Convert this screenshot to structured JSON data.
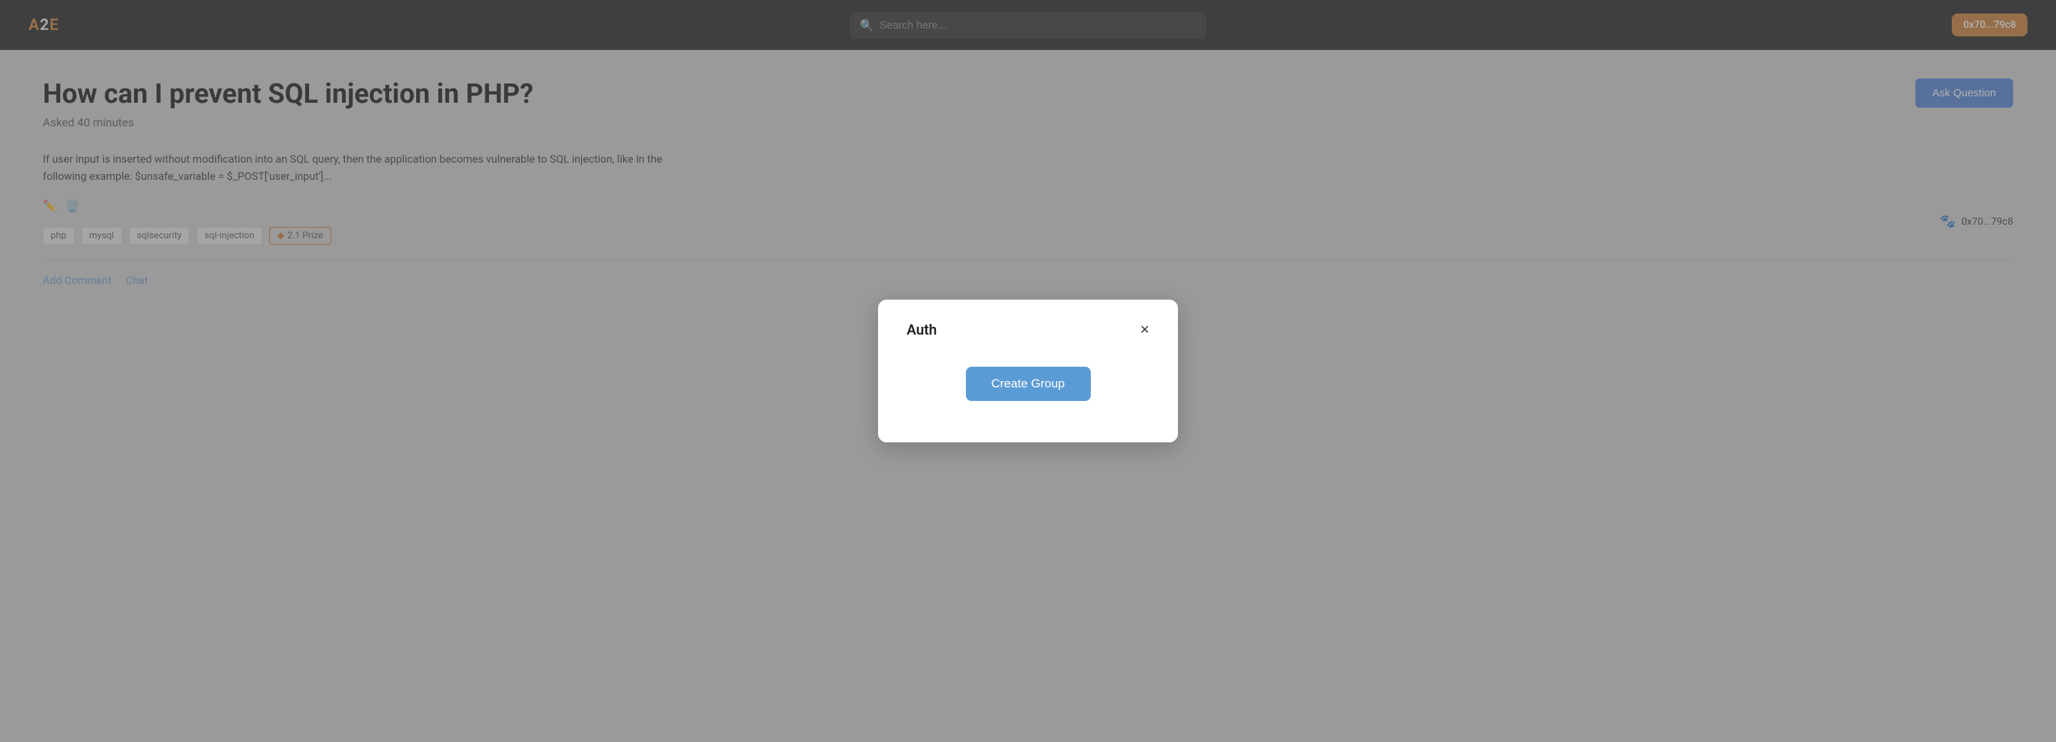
{
  "header": {
    "logo_a": "A",
    "logo_2": "2",
    "logo_e": "E",
    "search_placeholder": "Search here...",
    "wallet_address": "0x70...79c8"
  },
  "page": {
    "title": "How can I prevent SQL injection in PHP?",
    "asked": "Asked 40 minutes",
    "body": "If user input is inserted without modification into an SQL query, then the application becomes vulnerable to SQL injection, like in the following example: $unsafe_variable = $_POST['user_input']...",
    "ask_question_label": "Ask Question",
    "tags": [
      "php",
      "mysql",
      "sqlsecurity",
      "sql-injection"
    ],
    "prize_tag": "2.1 Prize",
    "author": "0x70...79c8",
    "add_comment": "Add Comment",
    "chat": "Chat"
  },
  "modal": {
    "title": "Auth",
    "close_symbol": "×",
    "create_group_label": "Create Group"
  }
}
